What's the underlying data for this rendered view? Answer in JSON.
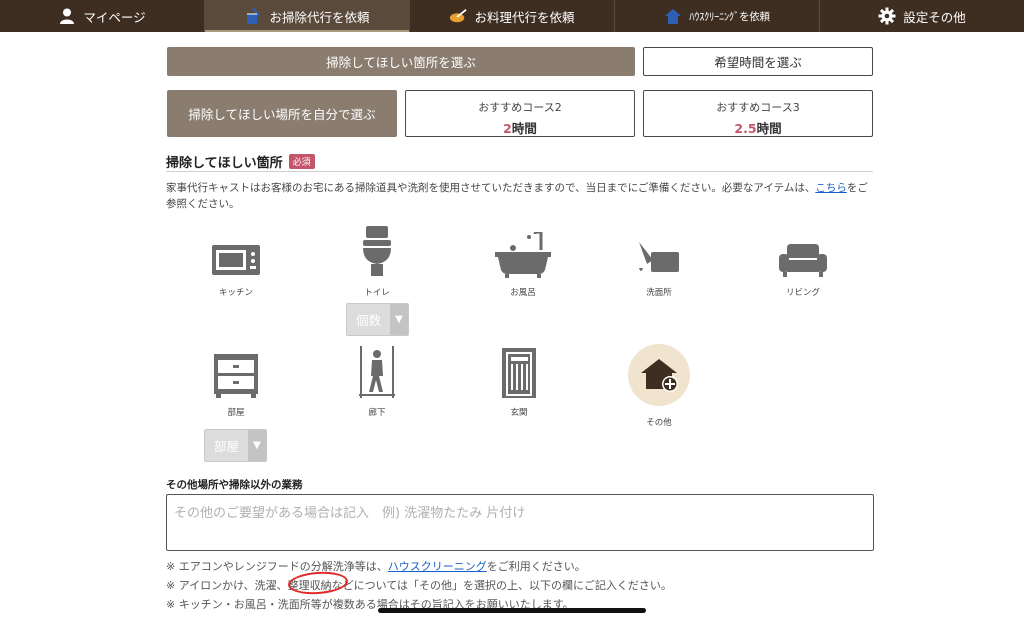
{
  "nav": {
    "items": [
      {
        "label": "マイページ",
        "icon": "person-icon"
      },
      {
        "label": "お掃除代行を依頼",
        "icon": "cleaning-icon"
      },
      {
        "label": "お料理代行を依頼",
        "icon": "cooking-pot-icon"
      },
      {
        "label": "ﾊｳｽｸﾘｰﾆﾝｸﾞを依頼",
        "icon": "house-icon"
      },
      {
        "label": "設定その他",
        "icon": "gear-icon"
      }
    ]
  },
  "tabs": {
    "select_places": "掃除してほしい箇所を選ぶ",
    "select_time": "希望時間を選ぶ",
    "select_self": "掃除してほしい場所を自分で選ぶ",
    "course2": {
      "name": "おすすめコース2",
      "hours_num": "2",
      "hours_unit": "時間"
    },
    "course3": {
      "name": "おすすめコース3",
      "hours_num": "2.5",
      "hours_unit": "時間"
    }
  },
  "section": {
    "title": "掃除してほしい箇所",
    "required": "必須",
    "desc_prefix": "家事代行キャストはお客様のお宅にある掃除道具や洗剤を使用させていただきますので、当日までにご準備ください。必要なアイテムは、",
    "desc_link": "こちら",
    "desc_suffix": "をご参照ください。"
  },
  "places": [
    {
      "label": "キッチン",
      "icon": "microwave-icon"
    },
    {
      "label": "トイレ",
      "icon": "toilet-icon"
    },
    {
      "label": "お風呂",
      "icon": "bathtub-icon"
    },
    {
      "label": "洗面所",
      "icon": "faucet-icon"
    },
    {
      "label": "リビング",
      "icon": "sofa-icon"
    },
    {
      "label": "部屋",
      "icon": "dresser-icon"
    },
    {
      "label": "廊下",
      "icon": "hallway-icon"
    },
    {
      "label": "玄関",
      "icon": "door-icon"
    },
    {
      "label": "その他",
      "icon": "house-plus-icon"
    }
  ],
  "selects": {
    "toilet_count": "個数",
    "room_count": "部屋"
  },
  "other": {
    "title": "その他場所や掃除以外の業務",
    "placeholder": "その他のご要望がある場合は記入　例) 洗濯物たたみ 片付け"
  },
  "notes": {
    "n1_prefix": "※ エアコンやレンジフードの分解洗浄等は、",
    "n1_link": "ハウスクリーニング",
    "n1_suffix": "をご利用ください。",
    "n2": "※ アイロンかけ、洗濯、整理収納などについては「その他」を選択の上、以下の欄にご記入ください。",
    "n3": "※ キッチン・お風呂・洗面所等が複数ある場合はその旨記入をお願いいたします。"
  },
  "colors": {
    "nav_bg": "#3e2e22",
    "accent": "#8a7d70",
    "required": "#c4566b",
    "link": "#1a5fc7"
  }
}
